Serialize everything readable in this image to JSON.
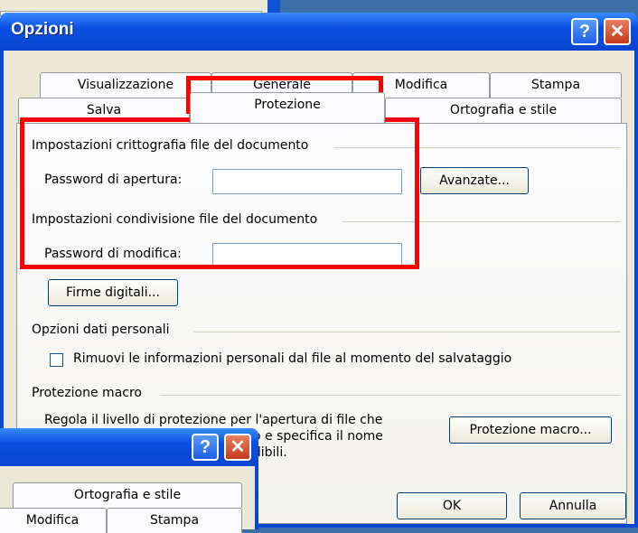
{
  "dialog": {
    "title": "Opzioni",
    "help_glyph": "?",
    "close_glyph": "✕"
  },
  "tabs": {
    "row1": [
      "Visualizzazione",
      "Generale",
      "Modifica",
      "Stampa"
    ],
    "row2": [
      "Salva",
      "Protezione",
      "Ortografia e stile"
    ],
    "active": "Protezione"
  },
  "encryption": {
    "group_label": "Impostazioni crittografia file del documento",
    "open_password_label": "Password di apertura:",
    "open_password_value": "",
    "advanced_button": "Avanzate..."
  },
  "sharing": {
    "group_label": "Impostazioni condivisione file del documento",
    "modify_password_label": "Password di modifica:",
    "modify_password_value": "",
    "digital_signatures_button": "Firme digitali..."
  },
  "privacy": {
    "group_label": "Opzioni dati personali",
    "remove_info_label": "Rimuovi le informazioni personali dal file al momento del salvataggio",
    "remove_info_checked": false
  },
  "macro": {
    "group_label": "Protezione macro",
    "description_line1": "Regola il livello di protezione per l'apertura di file che",
    "description_line2": "potrebbero contenere virus macro e specifica il nome",
    "description_line3": "ndibili.",
    "macro_security_button": "Protezione macro..."
  },
  "footer": {
    "ok_button": "OK",
    "cancel_button": "Annulla"
  },
  "secondary_dialog": {
    "help_glyph": "?",
    "close_glyph": "✕",
    "tab_row_top": [
      "Ortografia e stile"
    ],
    "tab_row_bottom": [
      "Modifica",
      "Stampa"
    ]
  },
  "colors": {
    "highlight": "#ff0000",
    "titlebar": "#0a4fe0",
    "client": "#ece9d8"
  }
}
